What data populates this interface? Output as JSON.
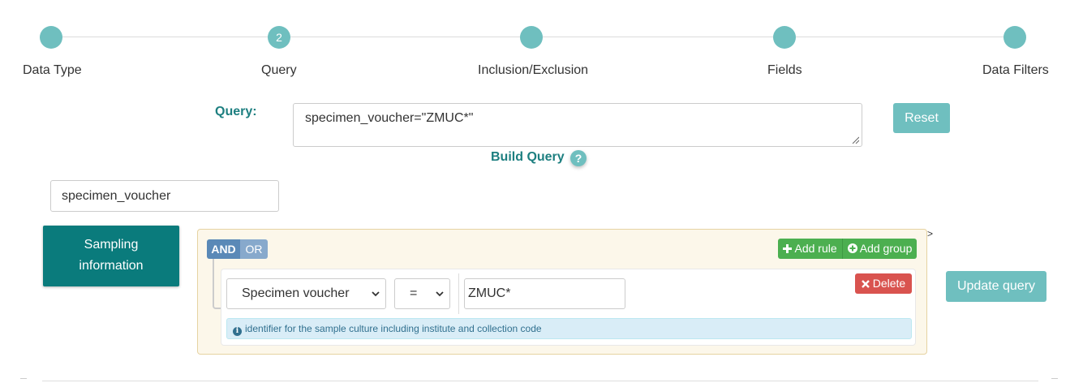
{
  "stepper": {
    "steps": [
      {
        "number": "",
        "label": "Data Type"
      },
      {
        "number": "2",
        "label": "Query"
      },
      {
        "number": "",
        "label": "Inclusion/Exclusion"
      },
      {
        "number": "",
        "label": "Fields"
      },
      {
        "number": "",
        "label": "Data Filters"
      }
    ],
    "current_step": 2
  },
  "query": {
    "label": "Query:",
    "value": "specimen_voucher=\"ZMUC*\"",
    "reset_label": "Reset",
    "build_query_label": "Build Query",
    "help_glyph": "?"
  },
  "field_search": {
    "value": "specimen_voucher"
  },
  "category": {
    "label_line1": "Sampling",
    "label_line2": "information"
  },
  "builder": {
    "and_label": "AND",
    "or_label": "OR",
    "add_rule_label": "Add rule",
    "add_group_label": "Add group",
    "gt_text": ">",
    "rule": {
      "field": "Specimen voucher",
      "operator": "=",
      "value": "ZMUC*",
      "delete_label": "Delete",
      "description": "identifier for the sample culture including institute and collection code"
    },
    "update_label": "Update query"
  },
  "colors": {
    "teal_accent": "#6fbfbf",
    "teal_dark": "#0a7b7c",
    "label_teal": "#1d7f80",
    "green": "#4caf50",
    "red": "#d9534f",
    "panel_bg": "#fcf7ea"
  },
  "icons": [
    "help-icon",
    "plus-icon",
    "plus-circle-icon",
    "close-icon",
    "info-icon",
    "chevron-down-icon",
    "resize-grip-icon"
  ]
}
